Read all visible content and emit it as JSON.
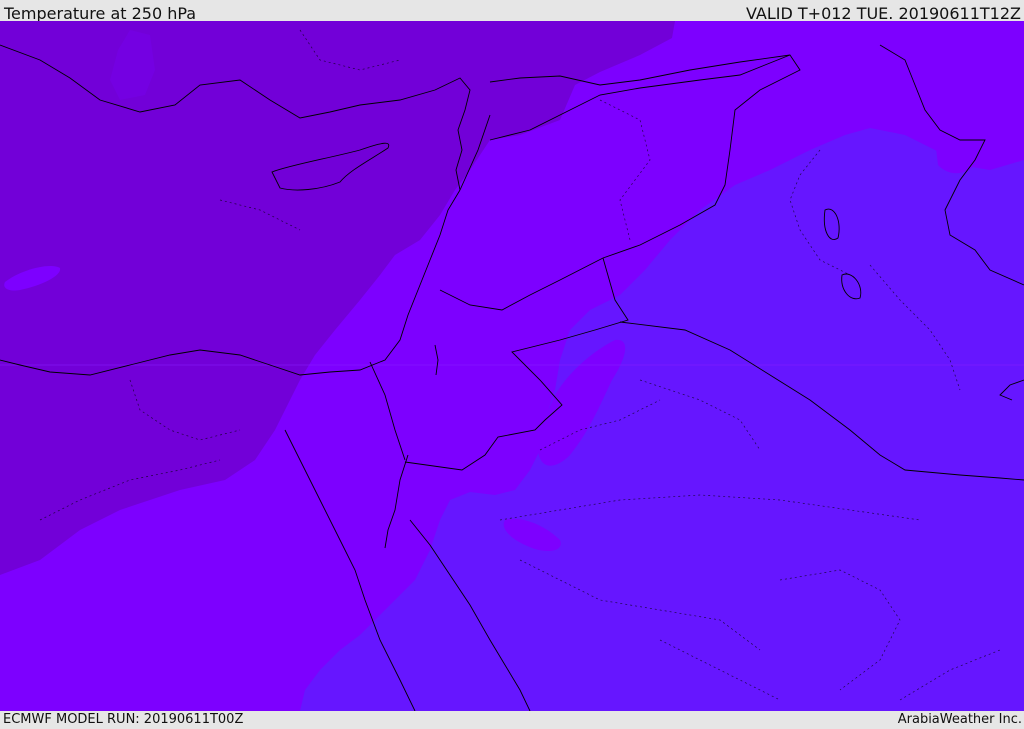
{
  "header": {
    "title": "Temperature at 250 hPa",
    "valid_time": "VALID T+012 TUE. 20190611T12Z"
  },
  "footer": {
    "model_run": "ECMWF MODEL RUN: 20190611T00Z",
    "credit": "ArabiaWeather Inc."
  },
  "colors": {
    "band_cold": "#7200d8",
    "band_mid": "#7d00ff",
    "band_warm": "#6616ff",
    "coastline": "#000000",
    "borders": "#000000",
    "header_bg": "#e6e6e6"
  }
}
